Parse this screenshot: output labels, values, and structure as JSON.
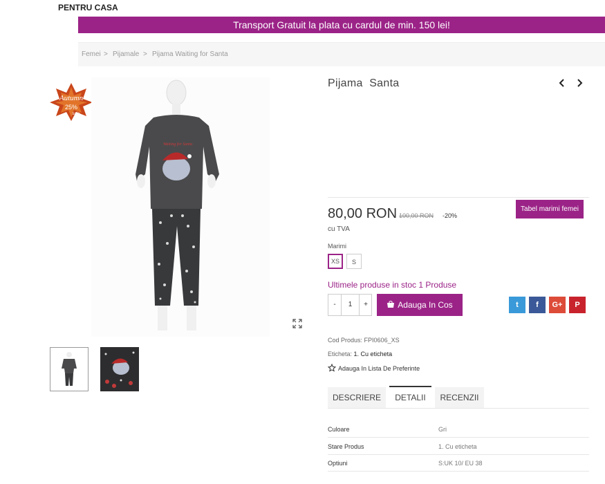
{
  "nav": {
    "top_label": "PENTRU CASA"
  },
  "banner": {
    "text": "Transport Gratuit la plata cu cardul de min. 150 lei!"
  },
  "breadcrumb": [
    {
      "label": "Femei"
    },
    {
      "label": "Pijamale"
    },
    {
      "label": "Pijama Waiting for Santa"
    }
  ],
  "product": {
    "title": "Pijama  Santa",
    "image_text": "Waiting for Santa",
    "badge_text": "Autumn 25% sale",
    "price": "80,00 RON",
    "old_price": "100,00 RON",
    "discount": "-20%",
    "tax_note": "cu TVA",
    "size_guide_button": "Tabel marimi femei",
    "sizes_label": "Marimi",
    "sizes": [
      {
        "label": "XS",
        "selected": true
      },
      {
        "label": "S",
        "selected": false
      }
    ],
    "stock_text": "Ultimele produse in stoc 1 Produse",
    "quantity": "1",
    "qty_minus": "-",
    "qty_plus": "+",
    "add_to_cart": "Adauga In Cos",
    "product_code_label": "Cod Produs:",
    "product_code": "FPI0606_XS",
    "label_label": "Eticheta:",
    "label_value": "1. Cu eticheta",
    "wishlist": "Adauga In Lista De Preferinte"
  },
  "social": [
    {
      "name": "twitter",
      "glyph": "t",
      "color": "#3a9ad9"
    },
    {
      "name": "facebook",
      "glyph": "f",
      "color": "#3b5998"
    },
    {
      "name": "google-plus",
      "glyph": "G+",
      "color": "#dd4b39"
    },
    {
      "name": "pinterest",
      "glyph": "P",
      "color": "#c8232c"
    }
  ],
  "tabs": [
    {
      "label": "DESCRIERE",
      "active": false
    },
    {
      "label": "DETALII",
      "active": true
    },
    {
      "label": "RECENZII",
      "active": false
    }
  ],
  "details": [
    {
      "label": "Culoare",
      "value": "Gri"
    },
    {
      "label": "Stare Produs",
      "value": "1. Cu eticheta"
    },
    {
      "label": "Optiuni",
      "value": "S:UK 10/ EU 38"
    }
  ],
  "colors": {
    "accent": "#9b2387"
  }
}
